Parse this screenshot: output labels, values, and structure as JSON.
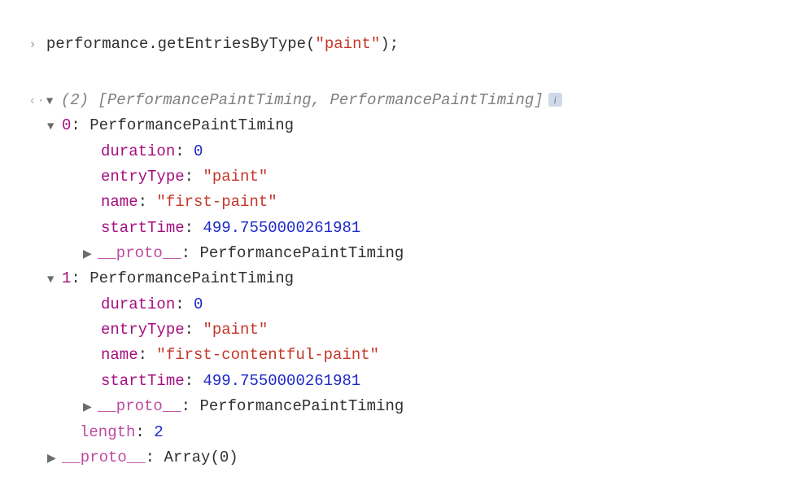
{
  "input": {
    "call_prefix": "performance",
    "method": ".getEntriesByType",
    "openParen": "(",
    "argQuoteOpen": "\"",
    "arg": "paint",
    "argQuoteClose": "\"",
    "closeParen": ")",
    "semicolon": ";"
  },
  "output": {
    "arrayCount": "(2)",
    "arraySummary": " [PerformancePaintTiming, PerformancePaintTiming]",
    "info": "i"
  },
  "entries": [
    {
      "indexLabel": "0",
      "className": "PerformancePaintTiming",
      "duration": {
        "key": "duration",
        "value": "0"
      },
      "entryType": {
        "key": "entryType",
        "value": "\"paint\""
      },
      "name": {
        "key": "name",
        "value": "\"first-paint\""
      },
      "startTime": {
        "key": "startTime",
        "value": "499.7550000261981"
      },
      "proto": {
        "key": "__proto__",
        "value": "PerformancePaintTiming"
      }
    },
    {
      "indexLabel": "1",
      "className": "PerformancePaintTiming",
      "duration": {
        "key": "duration",
        "value": "0"
      },
      "entryType": {
        "key": "entryType",
        "value": "\"paint\""
      },
      "name": {
        "key": "name",
        "value": "\"first-contentful-paint\""
      },
      "startTime": {
        "key": "startTime",
        "value": "499.7550000261981"
      },
      "proto": {
        "key": "__proto__",
        "value": "PerformancePaintTiming"
      }
    }
  ],
  "arrayTail": {
    "length": {
      "key": "length",
      "value": "2"
    },
    "proto": {
      "key": "__proto__",
      "value": "Array(0)"
    }
  },
  "symbols": {
    "right": "▶",
    "down": "▼",
    "inputChevron": "›",
    "returnChevron": "‹·"
  },
  "sep": ": "
}
